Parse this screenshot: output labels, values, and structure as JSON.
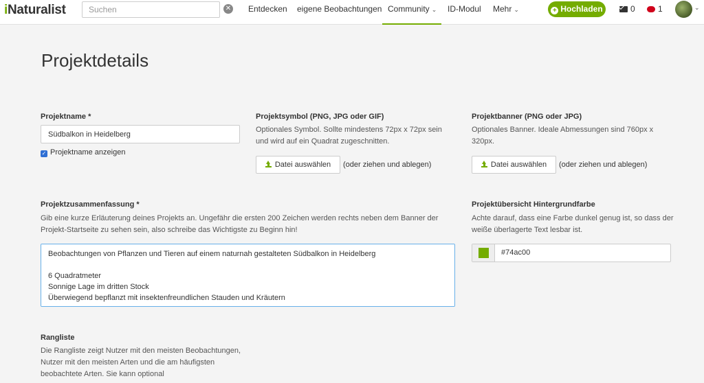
{
  "header": {
    "logo_first": "i",
    "logo_rest": "Naturalist",
    "search_placeholder": "Suchen",
    "clear_glyph": "✕",
    "nav": [
      {
        "label": "Entdecken"
      },
      {
        "label": "eigene Beobachtungen"
      },
      {
        "label": "Community",
        "chevron": "⌄"
      },
      {
        "label": "ID-Modul"
      },
      {
        "label": "Mehr",
        "chevron": "⌄"
      }
    ],
    "upload_label": "Hochladen",
    "upload_icon": "+",
    "messages_count": "0",
    "notifications_count": "1",
    "avatar_chevron": "⌄"
  },
  "page": {
    "title": "Projektdetails"
  },
  "project_name": {
    "label": "Projektname *",
    "value": "Südbalkon in Heidelberg",
    "show_checkbox_label": "Projektname anzeigen",
    "check_glyph": "✓"
  },
  "project_icon": {
    "label": "Projektsymbol (PNG, JPG oder GIF)",
    "help": "Optionales Symbol. Sollte mindestens 72px x 72px sein und wird auf ein Quadrat zugeschnitten.",
    "button": "Datei auswählen",
    "drop_hint": "(oder ziehen und ablegen)"
  },
  "project_banner": {
    "label": "Projektbanner (PNG oder JPG)",
    "help": "Optionales Banner. Ideale Abmessungen sind 760px x 320px.",
    "button": "Datei auswählen",
    "drop_hint": "(oder ziehen und ablegen)"
  },
  "summary": {
    "label": "Projektzusammenfassung *",
    "help": "Gib eine kurze Erläuterung deines Projekts an. Ungefähr die ersten 200 Zeichen werden rechts neben dem Banner der Projekt-Startseite zu sehen sein, also schreibe das Wichtigste zu Beginn hin!",
    "value": "Beobachtungen von Pflanzen und Tieren auf einem naturnah gestalteten Südbalkon in Heidelberg\n\n6 Quadratmeter\nSonnige Lage im dritten Stock\nÜberwiegend bepflanzt mit insektenfreundlichen Stauden und Kräutern"
  },
  "background_color": {
    "label": "Projektübersicht Hintergrundfarbe",
    "help": "Achte darauf, dass eine Farbe dunkel genug ist, so dass der weiße überlagerte Text lesbar ist.",
    "value": "#74ac00",
    "swatch_color": "#74ac00"
  },
  "leaderboard": {
    "label": "Rangliste",
    "help": "Die Rangliste zeigt Nutzer mit den meisten Beobachtungen, Nutzer mit den meisten Arten und die am häufigsten beobachtete Arten. Sie kann optional"
  }
}
